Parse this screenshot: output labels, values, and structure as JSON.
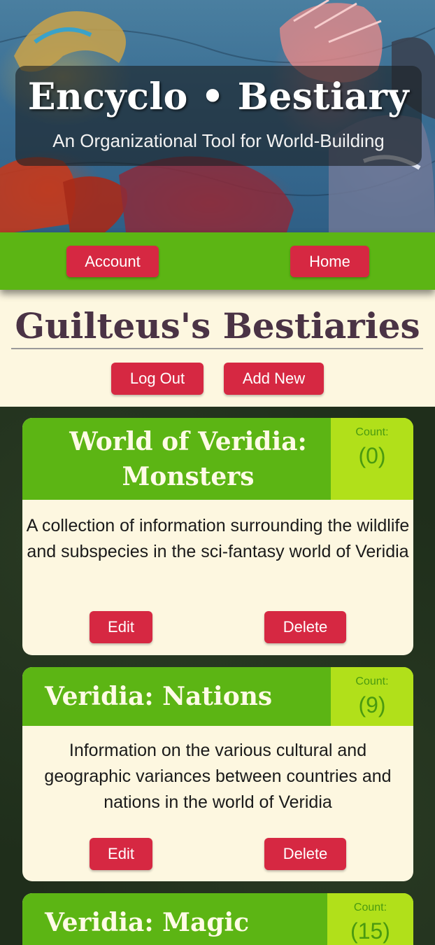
{
  "header": {
    "site_title": "Encyclo • Bestiary",
    "subtitle": "An Organizational Tool for World-Building"
  },
  "nav": {
    "account_label": "Account",
    "home_label": "Home"
  },
  "page": {
    "title": "Guilteus's Bestiaries",
    "logout_label": "Log Out",
    "add_new_label": "Add New"
  },
  "bestiaries": [
    {
      "title": "World of Veridia: Monsters",
      "count_label": "Count:",
      "count": "(0)",
      "description": "A collection of information surrounding the wildlife and subspecies in the sci-fantasy world of Veridia",
      "edit_label": "Edit",
      "delete_label": "Delete"
    },
    {
      "title": "Veridia: Nations",
      "count_label": "Count:",
      "count": "(9)",
      "description": "Information on the various cultural and geographic variances between countries and nations in the world of Veridia",
      "edit_label": "Edit",
      "delete_label": "Delete"
    },
    {
      "title": "Veridia: Magic",
      "count_label": "Count:",
      "count": "(15)"
    }
  ],
  "colors": {
    "nav_green": "#5cb514",
    "count_lime": "#b1e01a",
    "button_red": "#d62842",
    "cream": "#fdf7e0",
    "title_plum": "#4a3345",
    "background_dark": "#1f2e1b"
  }
}
